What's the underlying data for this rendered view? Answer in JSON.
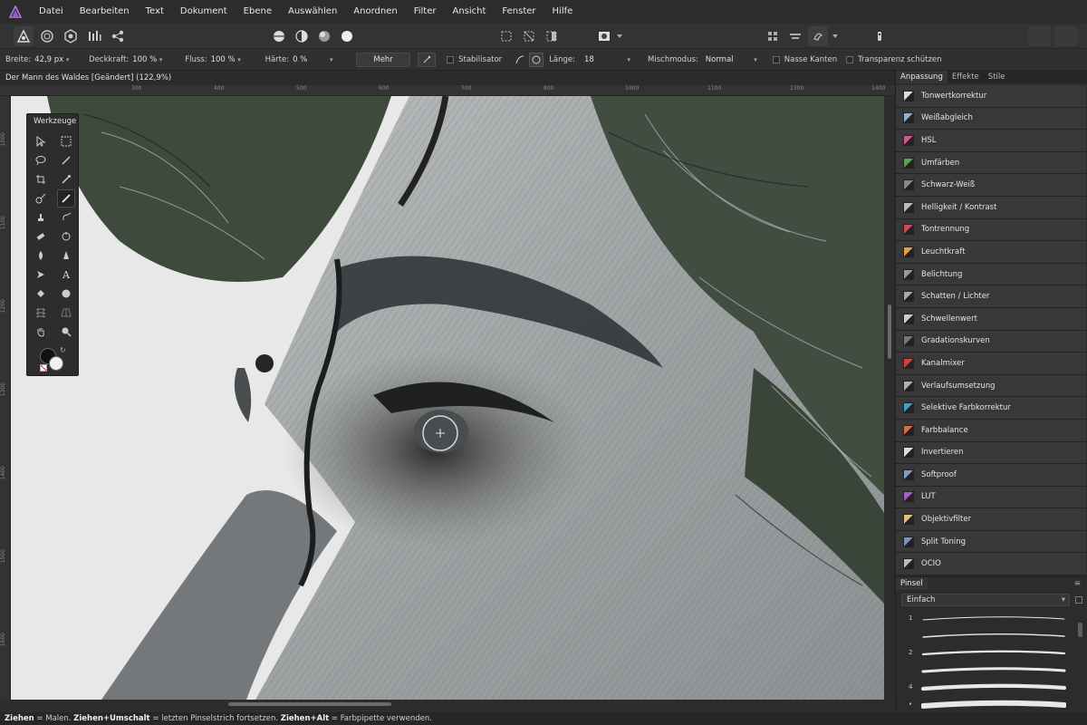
{
  "menu": [
    "Datei",
    "Bearbeiten",
    "Text",
    "Dokument",
    "Ebene",
    "Auswählen",
    "Anordnen",
    "Filter",
    "Ansicht",
    "Fenster",
    "Hilfe"
  ],
  "context": {
    "breite_label": "Breite:",
    "breite_value": "42,9 px",
    "deckkraft_label": "Deckkraft:",
    "deckkraft_value": "100 %",
    "fluss_label": "Fluss:",
    "fluss_value": "100 %",
    "haerte_label": "Härte:",
    "haerte_value": "0 %",
    "mehr_label": "Mehr",
    "stabilisator_label": "Stabilisator",
    "laenge_label": "Länge:",
    "laenge_value": "18",
    "mischmodus_label": "Mischmodus:",
    "mischmodus_value": "Normal",
    "nasse_kanten_label": "Nasse Kanten",
    "transparenz_label": "Transparenz schützen"
  },
  "document": {
    "title": "Der Mann des Waldes [Geändert] (122,9%)"
  },
  "ruler": {
    "h_ticks": [
      "300",
      "400",
      "500",
      "600",
      "700",
      "800",
      "900",
      "1000",
      "1100",
      "1200",
      "1300",
      "1400"
    ],
    "v_ticks": [
      "1000",
      "1100",
      "1200",
      "1300",
      "1400",
      "1500",
      "1600",
      "1700"
    ]
  },
  "tools": {
    "title": "Werkzeuge"
  },
  "panel": {
    "tabs": [
      "Anpassung",
      "Effekte",
      "Stile"
    ],
    "adjustments": [
      {
        "label": "Tonwertkorrektur",
        "icon": "levels-icon",
        "color": "#dddddd"
      },
      {
        "label": "Weißabgleich",
        "icon": "white-balance-icon",
        "color": "#8fb0d8"
      },
      {
        "label": "HSL",
        "icon": "hsl-icon",
        "color": "#c85a8c"
      },
      {
        "label": "Umfärben",
        "icon": "recolor-icon",
        "color": "#5aa05a"
      },
      {
        "label": "Schwarz-Weiß",
        "icon": "black-white-icon",
        "color": "#888888"
      },
      {
        "label": "Helligkeit / Kontrast",
        "icon": "brightness-icon",
        "color": "#bbbbbb"
      },
      {
        "label": "Tontrennung",
        "icon": "posterize-icon",
        "color": "#c84a5a"
      },
      {
        "label": "Leuchtkraft",
        "icon": "vibrance-icon",
        "color": "#e0a040"
      },
      {
        "label": "Belichtung",
        "icon": "exposure-icon",
        "color": "#999999"
      },
      {
        "label": "Schatten / Lichter",
        "icon": "shadows-highlights-icon",
        "color": "#aaaaaa"
      },
      {
        "label": "Schwellenwert",
        "icon": "threshold-icon",
        "color": "#cccccc"
      },
      {
        "label": "Gradationskurven",
        "icon": "curves-icon",
        "color": "#777777"
      },
      {
        "label": "Kanalmixer",
        "icon": "channel-mixer-icon",
        "color": "#d04040"
      },
      {
        "label": "Verlaufsumsetzung",
        "icon": "gradient-map-icon",
        "color": "#b0b0b0"
      },
      {
        "label": "Selektive Farbkorrektur",
        "icon": "selective-color-icon",
        "color": "#3aa0d0"
      },
      {
        "label": "Farbbalance",
        "icon": "color-balance-icon",
        "color": "#d0704a"
      },
      {
        "label": "Invertieren",
        "icon": "invert-icon",
        "color": "#dddddd"
      },
      {
        "label": "Softproof",
        "icon": "softproof-icon",
        "color": "#7aa0c8"
      },
      {
        "label": "LUT",
        "icon": "lut-icon",
        "color": "#a060c0"
      },
      {
        "label": "Objektivfilter",
        "icon": "lens-filter-icon",
        "color": "#e0c080"
      },
      {
        "label": "Split Toning",
        "icon": "split-toning-icon",
        "color": "#8090c0"
      },
      {
        "label": "OCIO",
        "icon": "ocio-icon",
        "color": "#bbbbbb"
      }
    ],
    "brush_tab": "Pinsel",
    "brush_category": "Einfach",
    "brush_sizes": [
      "1",
      "",
      "2",
      "",
      "4",
      "•"
    ]
  },
  "status": {
    "k1": "Ziehen",
    "t1": " = Malen. ",
    "k2": "Ziehen+Umschalt",
    "t2": " = letzten Pinselstrich fortsetzen. ",
    "k3": "Ziehen+Alt",
    "t3": " = Farbpipette verwenden."
  },
  "colors": {
    "accent": "#8e5ec8",
    "panel_bg": "#2c2c2c",
    "item_bg": "#383838"
  }
}
